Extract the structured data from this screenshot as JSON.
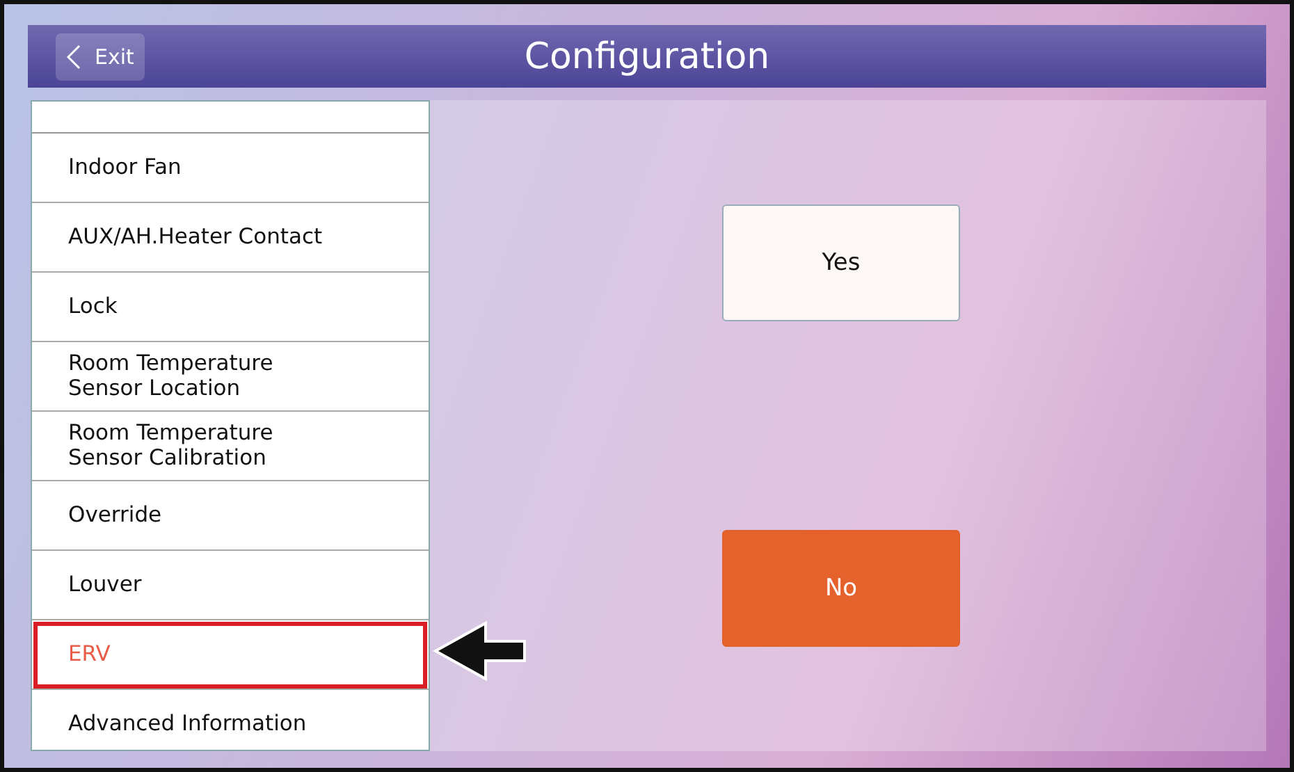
{
  "header": {
    "back_button": "Exit",
    "title": "Configuration"
  },
  "menu": [
    {
      "label": "Indoor Fan",
      "selected": false
    },
    {
      "label": "AUX/AH.Heater Contact",
      "selected": false
    },
    {
      "label": "Lock",
      "selected": false
    },
    {
      "label": "Room Temperature\nSensor Location",
      "selected": false
    },
    {
      "label": "Room Temperature\nSensor Calibration",
      "selected": false
    },
    {
      "label": "Override",
      "selected": false
    },
    {
      "label": "Louver",
      "selected": false
    },
    {
      "label": "ERV",
      "selected": true
    },
    {
      "label": "Advanced Information",
      "selected": false
    }
  ],
  "options": [
    {
      "label": "Yes",
      "selected": false
    },
    {
      "label": "No",
      "selected": true
    }
  ]
}
